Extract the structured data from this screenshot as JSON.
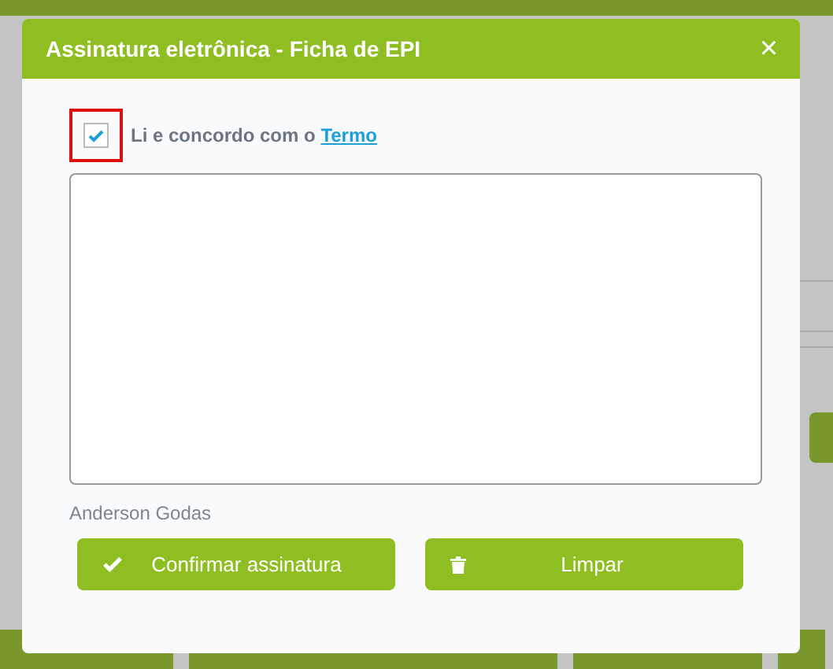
{
  "dialog": {
    "title": "Assinatura eletrônica - Ficha de EPI",
    "close": "×"
  },
  "agreement": {
    "checked": true,
    "highlighted": true,
    "text": "Li e concordo com o ",
    "link": "Termo"
  },
  "signer": "Anderson Godas",
  "buttons": [
    {
      "kind": "confirm",
      "label": "Confirmar assinatura"
    },
    {
      "kind": "clear",
      "label": "Limpar"
    }
  ]
}
